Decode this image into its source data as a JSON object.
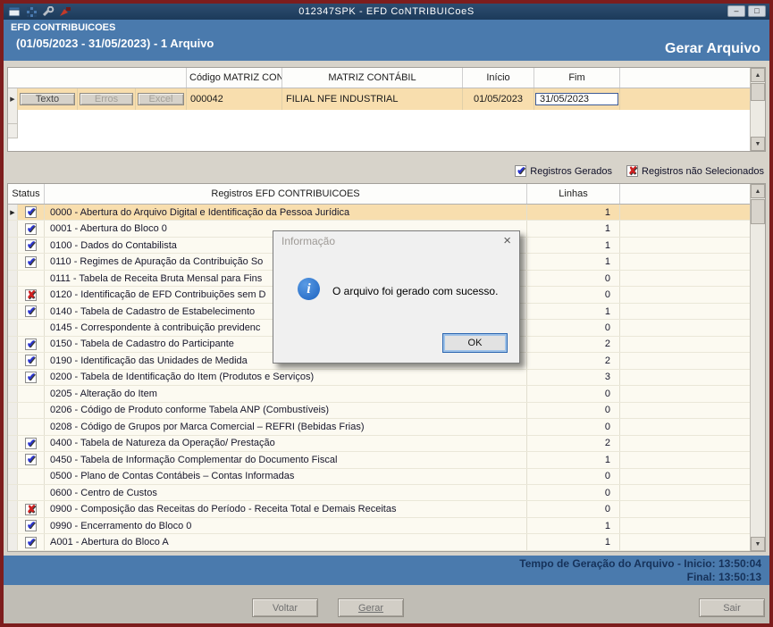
{
  "titlebar": {
    "title": "012347SPK - EFD CoNTRIBUICoeS"
  },
  "toolbar_icons": [
    "window-icon",
    "grid-icon",
    "wrench-icon",
    "brush-icon"
  ],
  "icons": {
    "minimize": "–",
    "maximize": "□",
    "close": "×",
    "scroll_up": "▲",
    "scroll_down": "▼",
    "row_pointer": "▶",
    "info": "i"
  },
  "header": {
    "app_name": "EFD CONTRIBUICOES",
    "period": "(01/05/2023 - 31/05/2023) - 1 Arquivo",
    "action": "Gerar Arquivo"
  },
  "file_grid": {
    "headers": {
      "codigo": "Código MATRIZ CONTÁBIL",
      "matriz": "MATRIZ CONTÁBIL",
      "inicio": "Início",
      "fim": "Fim"
    },
    "buttons": {
      "texto": "Texto",
      "erros": "Erros",
      "excel": "Excel"
    },
    "row": {
      "codigo": "000042",
      "matriz": "FILIAL NFE INDUSTRIAL",
      "inicio": "01/05/2023",
      "fim": "31/05/2023"
    }
  },
  "legend": {
    "generated": "Registros Gerados",
    "not_selected": "Registros não Selecionados"
  },
  "records_grid": {
    "headers": {
      "status": "Status",
      "registro": "Registros EFD CONTRIBUICOES",
      "linhas": "Linhas"
    },
    "rows": [
      {
        "status": "checked",
        "selected": true,
        "label": "0000 - Abertura do Arquivo Digital e Identificação da Pessoa Jurídica",
        "linhas": "1"
      },
      {
        "status": "checked",
        "label": "0001 - Abertura do Bloco 0",
        "linhas": "1"
      },
      {
        "status": "checked",
        "label": "0100 - Dados do Contabilista",
        "linhas": "1"
      },
      {
        "status": "checked",
        "label": "0110 - Regimes de Apuração da Contribuição So",
        "linhas": "1"
      },
      {
        "status": "none",
        "label": "0111 - Tabela de Receita Bruta Mensal para Fins",
        "linhas": "0"
      },
      {
        "status": "excluded",
        "label": "0120 - Identificação de EFD Contribuições sem D",
        "linhas": "0"
      },
      {
        "status": "checked",
        "label": "0140 - Tabela de Cadastro de Estabelecimento",
        "linhas": "1"
      },
      {
        "status": "none",
        "label": "0145 - Correspondente à contribuição previdenc",
        "linhas": "0"
      },
      {
        "status": "checked",
        "label": "0150 - Tabela de Cadastro do Participante",
        "linhas": "2"
      },
      {
        "status": "checked",
        "label": "0190 - Identificação das Unidades de Medida",
        "linhas": "2"
      },
      {
        "status": "checked",
        "label": "0200 - Tabela de Identificação do Item (Produtos e Serviços)",
        "linhas": "3"
      },
      {
        "status": "none",
        "label": "0205 - Alteração do Item",
        "linhas": "0"
      },
      {
        "status": "none",
        "label": "0206 - Código de Produto conforme Tabela ANP (Combustíveis)",
        "linhas": "0"
      },
      {
        "status": "none",
        "label": "0208 - Código de Grupos por Marca Comercial – REFRI (Bebidas Frias)",
        "linhas": "0"
      },
      {
        "status": "checked",
        "label": "0400 - Tabela de Natureza da Operação/ Prestação",
        "linhas": "2"
      },
      {
        "status": "checked",
        "label": "0450 - Tabela de Informação Complementar do Documento Fiscal",
        "linhas": "1"
      },
      {
        "status": "none",
        "label": "0500 - Plano de Contas Contábeis – Contas Informadas",
        "linhas": "0"
      },
      {
        "status": "none",
        "label": "0600 - Centro de Custos",
        "linhas": "0"
      },
      {
        "status": "excluded",
        "label": "0900 - Composição das Receitas do Período - Receita Total e Demais Receitas",
        "linhas": "0"
      },
      {
        "status": "checked",
        "label": "0990 - Encerramento do Bloco 0",
        "linhas": "1"
      },
      {
        "status": "checked",
        "label": "A001 - Abertura do Bloco A",
        "linhas": "1"
      }
    ]
  },
  "dialog": {
    "title": "Informação",
    "message": "O arquivo foi gerado com sucesso.",
    "ok_label": "OK"
  },
  "status_bar": {
    "line1": "Tempo de Geração do Arquivo - Inicio: 13:50:04",
    "line2": "Final: 13:50:13"
  },
  "footer": {
    "voltar": "Voltar",
    "gerar": "Gerar",
    "sair": "Sair"
  },
  "colors": {
    "accent_blue": "#4a7aad",
    "titlebar_navy": "#1c3a5a",
    "selected_row": "#f8deae",
    "check_blue": "#2b35cf",
    "cross_red": "#cf2020",
    "window_border": "#7d1d1d"
  }
}
